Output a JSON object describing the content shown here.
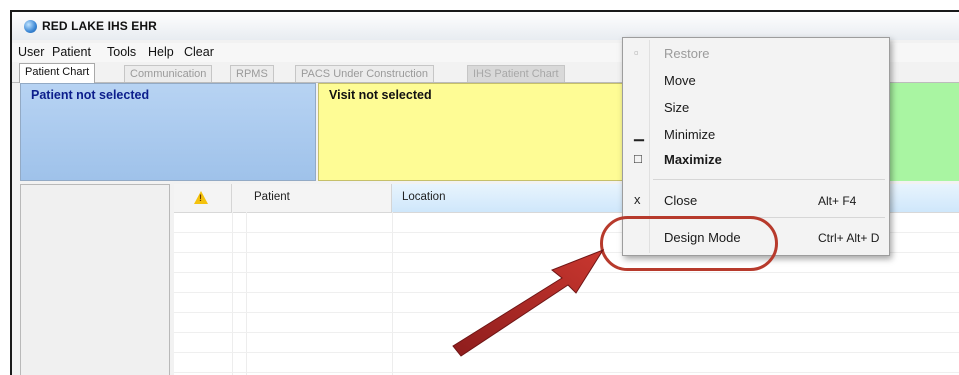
{
  "window": {
    "title": "RED LAKE IHS EHR",
    "icon": "app-globe-icon"
  },
  "menubar": {
    "items": [
      "User",
      "Patient",
      "Tools",
      "Help",
      "Clear"
    ]
  },
  "tabs": [
    {
      "label": "Patient Chart",
      "state": "active"
    },
    {
      "label": "Communication",
      "state": "normal"
    },
    {
      "label": "RPMS",
      "state": "normal"
    },
    {
      "label": "PACS Under Construction",
      "state": "normal"
    },
    {
      "label": "IHS Patient Chart",
      "state": "dim"
    }
  ],
  "banners": {
    "patient": "Patient not selected",
    "visit": "Visit not selected"
  },
  "grid": {
    "columns": [
      "",
      "Patient",
      "Location"
    ],
    "warning_icon": "warning-icon"
  },
  "context_menu": {
    "items": [
      {
        "label": "Restore",
        "glyph": "▫",
        "shortcut": "",
        "disabled": true
      },
      {
        "label": "Move",
        "glyph": "",
        "shortcut": ""
      },
      {
        "label": "Size",
        "glyph": "",
        "shortcut": ""
      },
      {
        "label": "Minimize",
        "glyph": "▁",
        "shortcut": ""
      },
      {
        "label": "Maximize",
        "glyph": "□",
        "shortcut": "",
        "bold": true
      },
      {
        "label": "Close",
        "glyph": "x",
        "shortcut": "Alt+ F4"
      },
      {
        "label": "Design Mode",
        "glyph": "",
        "shortcut": "Ctrl+ Alt+ D"
      }
    ]
  },
  "colors": {
    "patient_banner": "#a9c9ef",
    "visit_banner": "#fefc95",
    "annotation": "#b73a2c"
  }
}
